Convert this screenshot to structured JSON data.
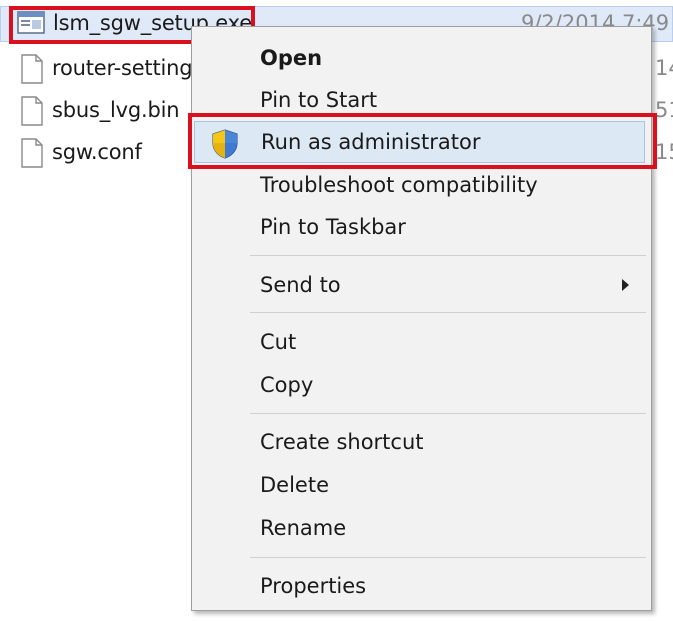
{
  "files": [
    {
      "name": "lsm_sgw_setup.exe",
      "date": "9/2/2014 7:49",
      "extra": "",
      "icon": "exe-file-icon"
    },
    {
      "name": "router-settings",
      "date": "",
      "extra": "14",
      "icon": "generic-file-icon"
    },
    {
      "name": "sbus_lvg.bin",
      "date": "",
      "extra": "51",
      "icon": "generic-file-icon"
    },
    {
      "name": "sgw.conf",
      "date": "",
      "extra": "15",
      "icon": "generic-file-icon"
    }
  ],
  "context_menu": {
    "items": [
      {
        "label": "Open"
      },
      {
        "label": "Pin to Start"
      },
      {
        "label": "Run as administrator",
        "icon": "uac-shield-icon"
      },
      {
        "label": "Troubleshoot compatibility"
      },
      {
        "label": "Pin to Taskbar"
      },
      {
        "label": "Send to",
        "icon": "submenu-arrow-icon"
      },
      {
        "label": "Cut"
      },
      {
        "label": "Copy"
      },
      {
        "label": "Create shortcut"
      },
      {
        "label": "Delete"
      },
      {
        "label": "Rename"
      },
      {
        "label": "Properties"
      }
    ]
  },
  "colors": {
    "highlight_border": "#d9101e",
    "hover_background": "#dde8f5",
    "menu_background": "#f2f2f2"
  }
}
